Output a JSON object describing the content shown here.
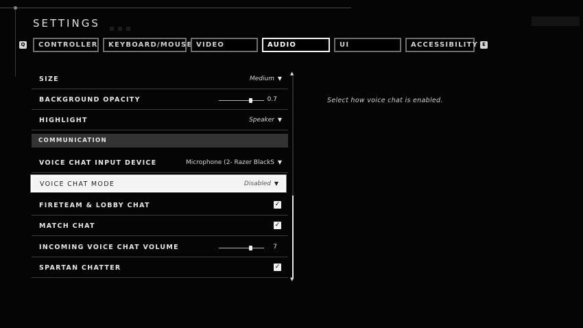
{
  "header": {
    "title": "SETTINGS",
    "bumper_left": "Q",
    "bumper_right": "E"
  },
  "tabs": [
    {
      "label": "CONTROLLER",
      "active": false
    },
    {
      "label": "KEYBOARD/MOUSE",
      "active": false
    },
    {
      "label": "VIDEO",
      "active": false
    },
    {
      "label": "AUDIO",
      "active": true
    },
    {
      "label": "UI",
      "active": false
    },
    {
      "label": "ACCESSIBILITY",
      "active": false
    }
  ],
  "settings": {
    "size": {
      "label": "SIZE",
      "value": "Medium"
    },
    "background_opacity": {
      "label": "BACKGROUND OPACITY",
      "value": "0.7",
      "level": 0.7
    },
    "highlight": {
      "label": "HIGHLIGHT",
      "value": "Speaker"
    },
    "communication": {
      "label": "COMMUNICATION"
    },
    "voice_input_device": {
      "label": "VOICE CHAT INPUT DEVICE",
      "value": "Microphone (2- Razer BlackS"
    },
    "voice_chat_mode": {
      "label": "VOICE CHAT MODE",
      "value": "Disabled"
    },
    "fireteam_lobby_chat": {
      "label": "FIRETEAM & LOBBY CHAT",
      "checked": true
    },
    "match_chat": {
      "label": "MATCH CHAT",
      "checked": true
    },
    "incoming_voice_volume": {
      "label": "INCOMING VOICE CHAT VOLUME",
      "value": "7",
      "level": 0.7
    },
    "spartan_chatter": {
      "label": "SPARTAN CHATTER",
      "checked": true
    }
  },
  "description": "Select how voice chat is enabled.",
  "glyphs": {
    "caret": "▼",
    "check": "✓",
    "scroll_up": "▲",
    "scroll_down": "▼"
  },
  "colors": {
    "background": "#050505",
    "active_tab_border": "#f2f2f2",
    "selected_row_bg": "#f4f4f4",
    "section_bg": "#333333"
  }
}
